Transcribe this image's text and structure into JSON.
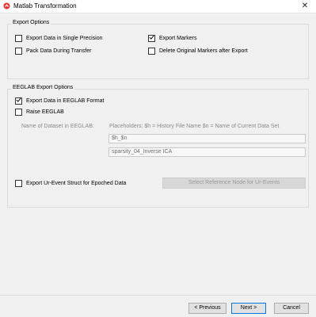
{
  "window": {
    "title": "Matlab Transformation",
    "close_glyph": "✕",
    "icon": "matlab-logo-icon"
  },
  "export_options": {
    "legend": "Export Options",
    "single_precision": {
      "label": "Export Data in Single Precision",
      "checked": false
    },
    "pack_data": {
      "label": "Pack Data During Transfer",
      "checked": false
    },
    "export_markers": {
      "label": "Export Markers",
      "checked": true
    },
    "delete_markers": {
      "label": "Delete Original Markers after Export",
      "checked": false
    }
  },
  "eeglab": {
    "legend": "EEGLAB Export Options",
    "eeglab_format": {
      "label": "Export Data in EEGLAB Format",
      "checked": true
    },
    "raise_eeglab": {
      "label": "Raise EEGLAB",
      "checked": false
    },
    "dataset_name_label": "Name of Dataset in EEGLAB:",
    "placeholders_text": "Placeholders:   $h = History File Name    $n = Name of Current Data Set",
    "name_pattern_value": "$h_$n",
    "name_preview_value": "sparsity_04_Inverse ICA",
    "ur_event": {
      "label": "Export Ur-Event Struct for Epoched Data",
      "checked": false
    },
    "reference_node_button": "Select Reference Node for Ur-Events"
  },
  "footer": {
    "previous": "< Previous",
    "next": "Next >",
    "cancel": "Cancel"
  }
}
